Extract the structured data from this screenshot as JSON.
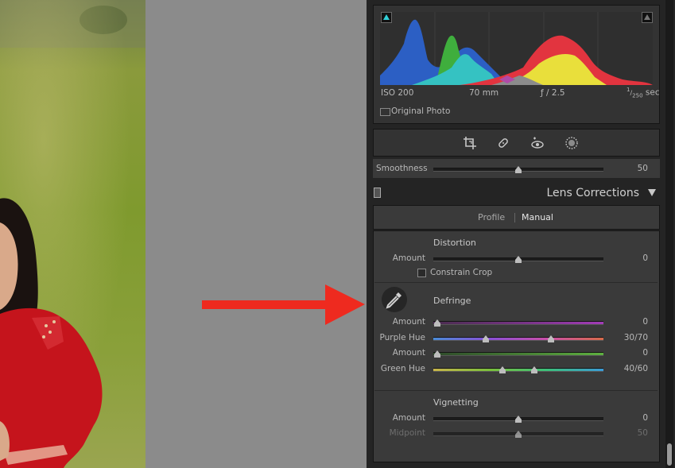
{
  "histogram": {
    "iso": "ISO 200",
    "focal_length": "70 mm",
    "aperture": "ƒ / 2.5",
    "shutter_num": "1",
    "shutter_den": "250",
    "shutter_unit": "sec",
    "original_photo_label": "Original Photo"
  },
  "tools": [
    "crop-icon",
    "heal-icon",
    "red-eye-icon",
    "mask-icon"
  ],
  "smoothness": {
    "label": "Smoothness",
    "value": "50",
    "level": 0.5
  },
  "lens_corrections": {
    "title": "Lens Corrections",
    "tabs": [
      {
        "label": "Profile"
      },
      {
        "label": "Manual"
      }
    ],
    "active_tab": "Manual",
    "distortion": {
      "heading": "Distortion",
      "amount_label": "Amount",
      "amount_value": "0",
      "constrain_crop_label": "Constrain Crop"
    },
    "defringe": {
      "heading": "Defringe",
      "purple_amount_label": "Amount",
      "purple_amount_value": "0",
      "purple_hue_label": "Purple Hue",
      "purple_hue_value": "30/70",
      "green_amount_label": "Amount",
      "green_amount_value": "0",
      "green_hue_label": "Green Hue",
      "green_hue_value": "40/60"
    },
    "vignetting": {
      "heading": "Vignetting",
      "amount_label": "Amount",
      "amount_value": "0",
      "midpoint_label": "Midpoint",
      "midpoint_value": "50"
    }
  },
  "colors": {
    "annotation_arrow": "#ee2a1f",
    "panel_bg": "#242424",
    "section_bg": "#3a3a3a"
  }
}
